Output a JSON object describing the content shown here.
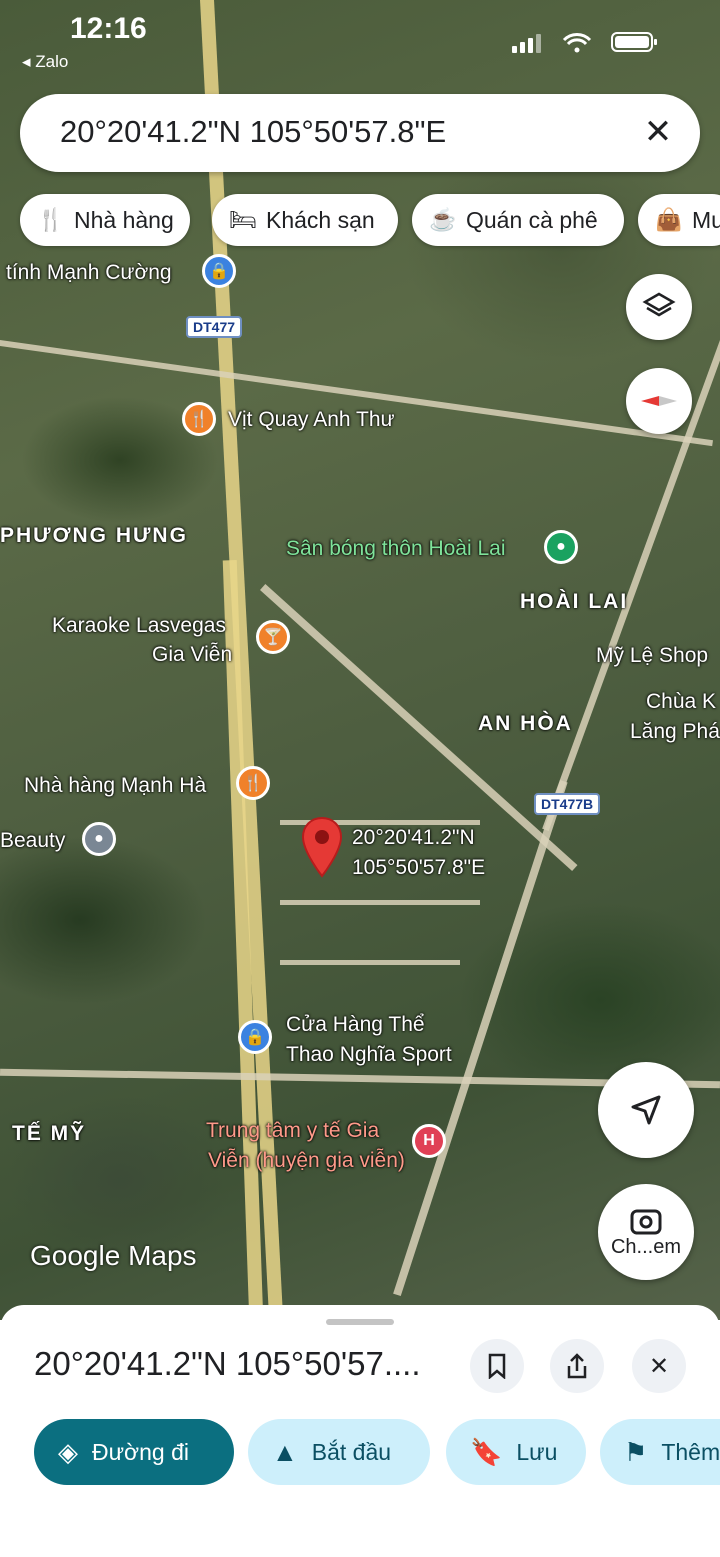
{
  "status_bar": {
    "time": "12:16",
    "back_app": "◂ Zalo"
  },
  "search": {
    "query": "20°20'41.2\"N 105°50'57.8\"E",
    "clear_icon": "close-icon"
  },
  "chips": [
    {
      "label": "Nhà hàng",
      "icon": "restaurant-icon"
    },
    {
      "label": "Khách sạn",
      "icon": "hotel-icon"
    },
    {
      "label": "Quán cà phê",
      "icon": "coffee-icon"
    },
    {
      "label": "Mu",
      "icon": "shopping-bag-icon"
    }
  ],
  "map": {
    "places": {
      "manh_cuong": "tính Mạnh Cường",
      "vit_quay": "Vịt Quay Anh Thư",
      "phuong_hung": "PHƯƠNG HƯNG",
      "san_bong": "Sân bóng thôn Hoài Lai",
      "hoai_lai": "HOÀI LAI",
      "karaoke_1": "Karaoke Lasvegas",
      "karaoke_2": "Gia Viễn",
      "my_le": "Mỹ Lệ Shop",
      "chua_1": "Chùa K",
      "chua_2": "Lăng Phá",
      "an_hoa": "AN HÒA",
      "nha_hang": "Nhà hàng Mạnh Hà",
      "beauty": "Beauty",
      "pin_1": "20°20'41.2\"N",
      "pin_2": "105°50'57.8\"E",
      "cua_hang_1": "Cửa Hàng Thể",
      "cua_hang_2": "Thao Nghĩa Sport",
      "te_my": "TẾ MỸ",
      "trung_tam_1": "Trung tâm y tế Gia",
      "trung_tam_2": "Viễn (huyện gia viễn)"
    },
    "road_shields": {
      "dt477": "DT477",
      "dt477b": "DT477B"
    },
    "watermark": "Google Maps",
    "camera_button_label": "Ch...em"
  },
  "sheet": {
    "title": "20°20'41.2\"N 105°50'57....",
    "actions": [
      {
        "label": "Đường đi",
        "icon": "directions-icon"
      },
      {
        "label": "Bắt đầu",
        "icon": "navigation-icon"
      },
      {
        "label": "Lưu",
        "icon": "bookmark-icon"
      },
      {
        "label": "Thêm",
        "icon": "flag-icon"
      }
    ]
  },
  "colors": {
    "primary_action": "#0b6f80",
    "secondary_action": "#cdeffb",
    "pin": "#e53935"
  }
}
